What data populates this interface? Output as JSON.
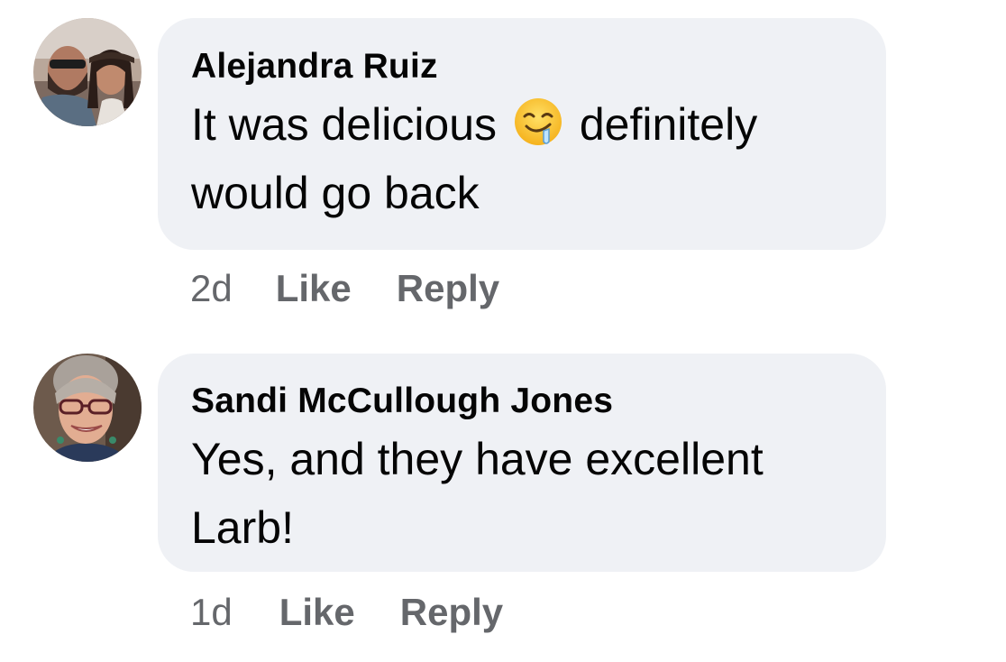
{
  "comments": [
    {
      "author": "Alejandra Ruiz",
      "text_before_emoji": "It was delicious",
      "emoji": "drooling-face",
      "text_after_emoji": "definitely would go back",
      "time": "2d",
      "like_label": "Like",
      "reply_label": "Reply",
      "avatar": "couple-selfie-avatar"
    },
    {
      "author": "Sandi McCullough Jones",
      "text": "Yes, and they have excellent Larb!",
      "time": "1d",
      "like_label": "Like",
      "reply_label": "Reply",
      "avatar": "woman-with-glasses-avatar"
    }
  ],
  "colors": {
    "bubble": "#eff1f5",
    "text": "#050505",
    "secondary": "#65676b"
  }
}
